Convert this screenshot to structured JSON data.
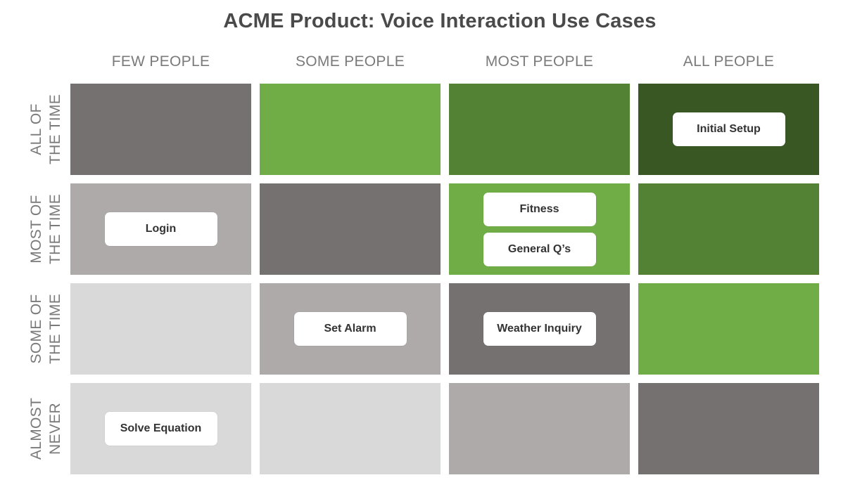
{
  "title": "ACME Product: Voice Interaction Use Cases",
  "columns": [
    "FEW PEOPLE",
    "SOME PEOPLE",
    "MOST PEOPLE",
    "ALL PEOPLE"
  ],
  "rows": [
    {
      "line1": "ALL OF",
      "line2": "THE TIME"
    },
    {
      "line1": "MOST OF",
      "line2": "THE TIME"
    },
    {
      "line1": "SOME OF",
      "line2": "THE TIME"
    },
    {
      "line1": "ALMOST",
      "line2": "NEVER"
    }
  ],
  "palette": {
    "very_light_gray": "#d9d9d9",
    "light_gray": "#aeaaaa",
    "dark_gray": "#757170",
    "light_green": "#70ad47",
    "mid_green": "#548235",
    "dark_green": "#385723"
  },
  "grid": [
    [
      {
        "color": "#757170",
        "items": []
      },
      {
        "color": "#70ad47",
        "items": []
      },
      {
        "color": "#548235",
        "items": []
      },
      {
        "color": "#385723",
        "items": [
          "Initial Setup"
        ]
      }
    ],
    [
      {
        "color": "#aeaaaa",
        "items": [
          "Login"
        ]
      },
      {
        "color": "#757170",
        "items": []
      },
      {
        "color": "#70ad47",
        "items": [
          "Fitness",
          "General Q’s"
        ]
      },
      {
        "color": "#548235",
        "items": []
      }
    ],
    [
      {
        "color": "#d9d9d9",
        "items": []
      },
      {
        "color": "#aeaaaa",
        "items": [
          "Set Alarm"
        ]
      },
      {
        "color": "#757170",
        "items": [
          "Weather Inquiry"
        ]
      },
      {
        "color": "#70ad47",
        "items": []
      }
    ],
    [
      {
        "color": "#d9d9d9",
        "items": [
          "Solve Equation"
        ]
      },
      {
        "color": "#d9d9d9",
        "items": []
      },
      {
        "color": "#aeaaaa",
        "items": []
      },
      {
        "color": "#757170",
        "items": []
      }
    ]
  ]
}
